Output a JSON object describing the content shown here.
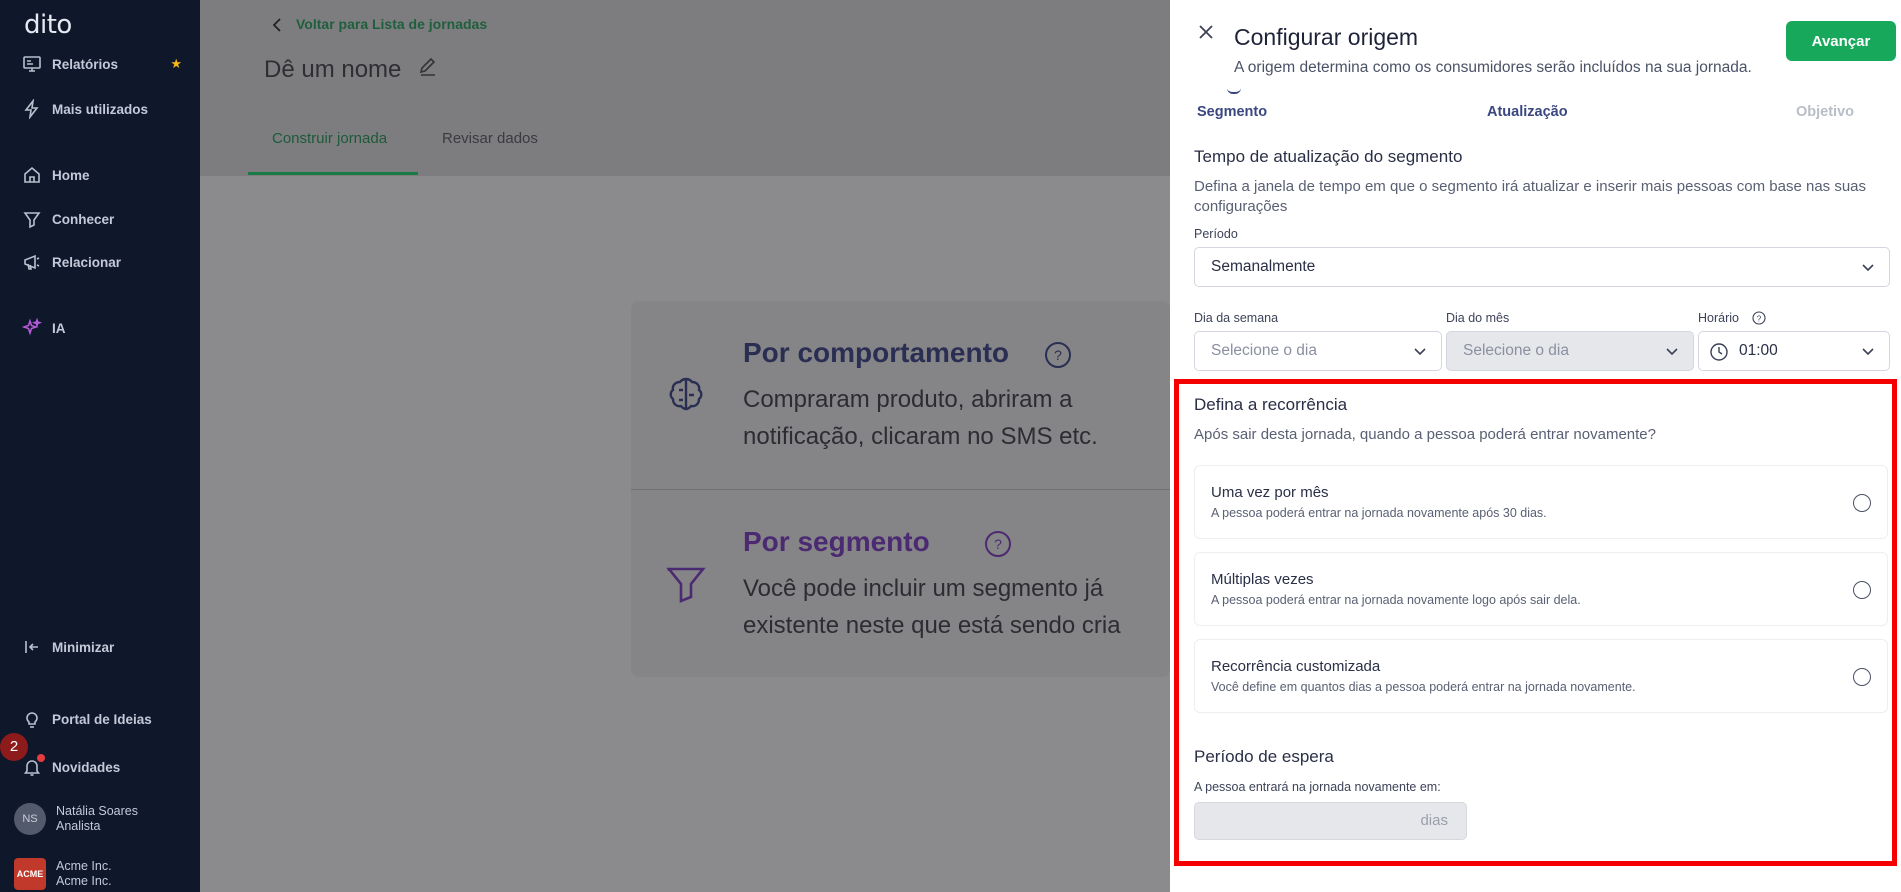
{
  "sidebar": {
    "logo": "dito",
    "items": [
      {
        "label": "Relatórios"
      },
      {
        "label": "Mais utilizados"
      },
      {
        "label": "Home"
      },
      {
        "label": "Conhecer"
      },
      {
        "label": "Relacionar"
      },
      {
        "label": "IA"
      }
    ],
    "favorite_star": "★",
    "minimize": "Minimizar",
    "ideas_portal": "Portal de Ideias",
    "news": "Novidades",
    "news_badge": "2",
    "user": {
      "initials": "NS",
      "name": "Natália Soares",
      "role": "Analista"
    },
    "company": {
      "logo_text": "ACME",
      "name": "Acme Inc.",
      "sub": "Acme Inc."
    }
  },
  "main": {
    "back_link": "Voltar para Lista de jornadas",
    "title": "Dê um nome",
    "tabs": [
      {
        "label": "Construir jornada"
      },
      {
        "label": "Revisar dados"
      }
    ],
    "cards": [
      {
        "title": "Por comportamento",
        "desc_line1": "Compraram produto, abriram a",
        "desc_line2": "notificação, clicaram no SMS etc."
      },
      {
        "title": "Por segmento",
        "desc_line1": "Você pode incluir um segmento já",
        "desc_line2": "existente neste que está sendo cria"
      }
    ]
  },
  "panel": {
    "title": "Configurar origem",
    "subtitle": "A origem determina como os consumidores serão incluídos na sua jornada.",
    "advance_label": "Avançar",
    "steps": [
      {
        "label": "Segmento"
      },
      {
        "label": "Atualização"
      },
      {
        "label": "Objetivo"
      }
    ],
    "update": {
      "title": "Tempo de atualização do segmento",
      "desc": "Defina a janela de tempo em que o segmento irá atualizar e inserir mais pessoas com base nas suas configurações",
      "period_label": "Período",
      "period_value": "Semanalmente",
      "weekday_label": "Dia da semana",
      "weekday_placeholder": "Selecione o dia",
      "monthday_label": "Dia do mês",
      "monthday_placeholder": "Selecione o dia",
      "time_label": "Horário",
      "time_value": "01:00"
    },
    "recurrence": {
      "title": "Defina a recorrência",
      "desc": "Após sair desta jornada, quando a pessoa poderá entrar novamente?",
      "options": [
        {
          "title": "Uma vez por mês",
          "desc": "A pessoa poderá entrar na jornada novamente após 30 dias."
        },
        {
          "title": "Múltiplas vezes",
          "desc": "A pessoa poderá entrar na jornada novamente logo após sair dela."
        },
        {
          "title": "Recorrência customizada",
          "desc": "Você define em quantos dias a pessoa poderá entrar na jornada novamente."
        }
      ]
    },
    "wait": {
      "title": "Período de espera",
      "label": "A pessoa entrará na jornada novamente em:",
      "unit": "dias"
    }
  },
  "colors": {
    "accent": "#17a85b",
    "sidebar_bg": "#0f172b",
    "highlight": "#f50000"
  }
}
